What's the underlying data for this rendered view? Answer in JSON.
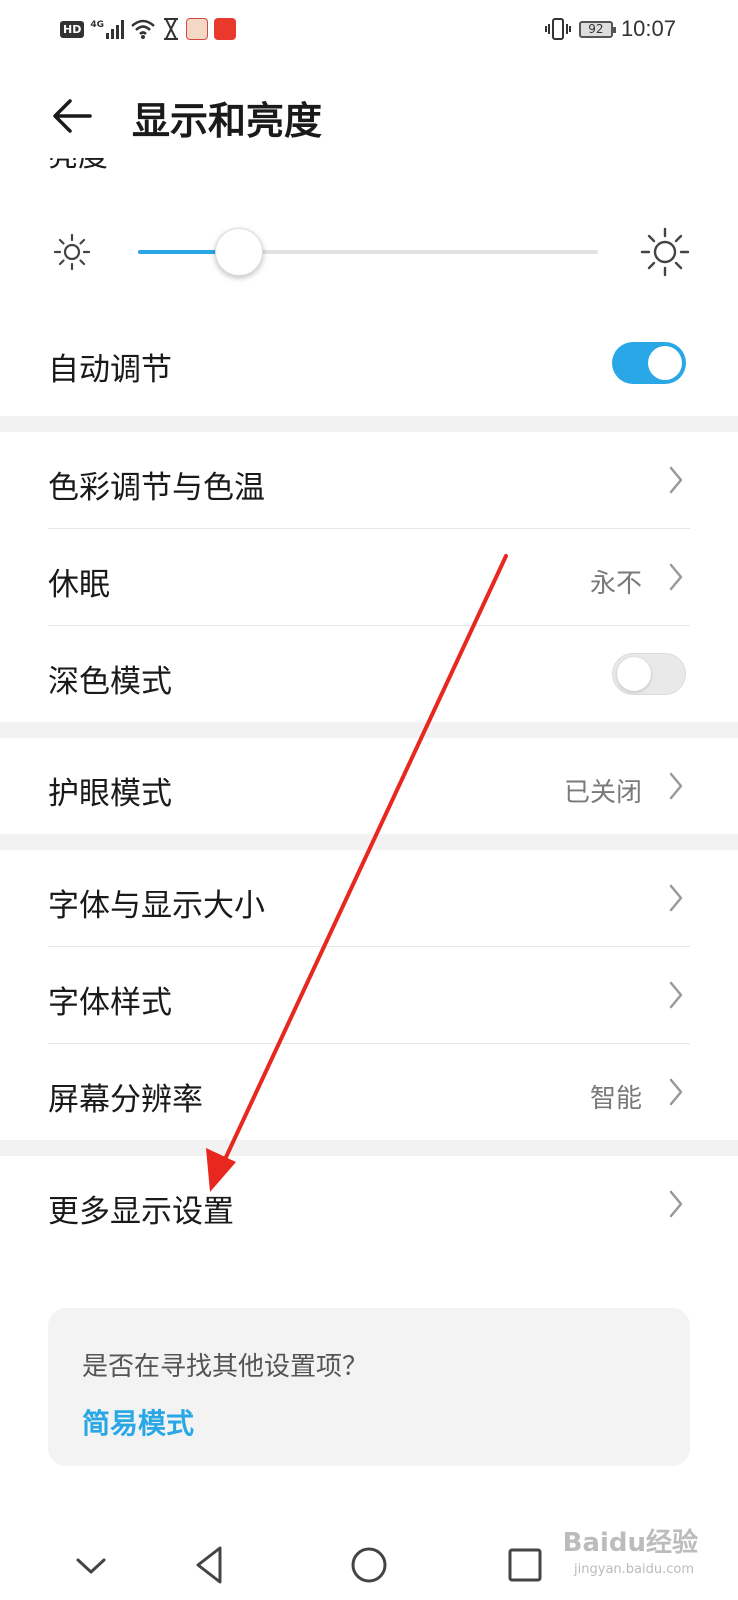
{
  "status_bar": {
    "hd_label": "HD",
    "network_label": "4G",
    "battery_level": "92",
    "time": "10:07",
    "icons": [
      "signal-icon",
      "wifi-icon",
      "hourglass-icon",
      "app-notification-icon",
      "app-notification-icon",
      "vibrate-icon",
      "battery-icon"
    ]
  },
  "header": {
    "title": "显示和亮度"
  },
  "brightness": {
    "section_label": "亮度",
    "level_fraction": 0.22
  },
  "auto_adjust": {
    "label": "自动调节",
    "enabled": true
  },
  "group1": [
    {
      "label": "色彩调节与色温",
      "value": ""
    },
    {
      "label": "休眠",
      "value": "永不"
    },
    {
      "label": "深色模式",
      "toggle": false
    }
  ],
  "group2": [
    {
      "label": "护眼模式",
      "value": "已关闭"
    }
  ],
  "group3": [
    {
      "label": "字体与显示大小",
      "value": ""
    },
    {
      "label": "字体样式",
      "value": ""
    },
    {
      "label": "屏幕分辨率",
      "value": "智能"
    }
  ],
  "group4": [
    {
      "label": "更多显示设置",
      "value": ""
    }
  ],
  "tip": {
    "question": "是否在寻找其他设置项？",
    "link": "简易模式"
  },
  "watermark": {
    "text": "Baidu经验",
    "sub": "jingyan.baidu.com"
  },
  "colors": {
    "accent": "#2aa7e6",
    "annotation": "#e8271f"
  }
}
